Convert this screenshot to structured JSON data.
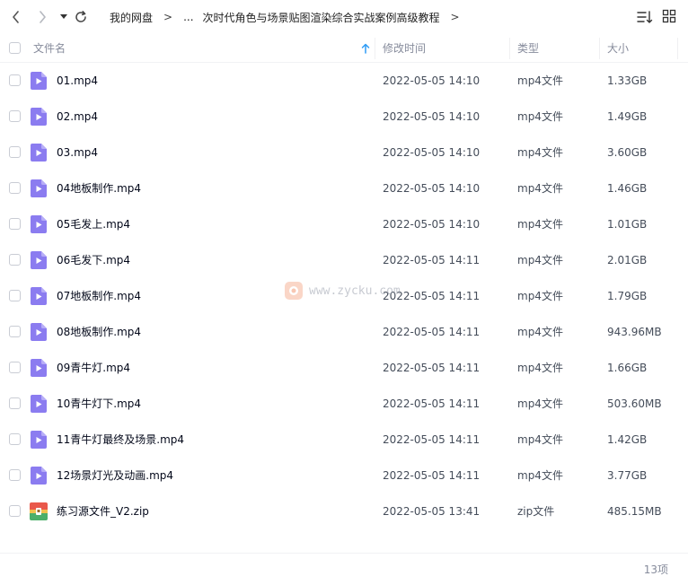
{
  "toolbar": {
    "back_icon": "chevron-left-icon",
    "forward_icon": "chevron-right-icon",
    "history_dropdown_icon": "caret-down-icon",
    "refresh_icon": "refresh-icon",
    "sort_icon": "sort-list-icon",
    "view_icon": "grid-view-icon"
  },
  "breadcrumb": {
    "root": "我的网盘",
    "separator": ">",
    "ellipsis": "...",
    "current": "次时代角色与场景贴图渲染综合实战案例高级教程",
    "trailing": ">"
  },
  "table": {
    "headers": {
      "name": "文件名",
      "modified": "修改时间",
      "type": "类型",
      "size": "大小"
    },
    "sort_indicator": "up-arrow-icon",
    "rows": [
      {
        "name": "01.mp4",
        "modified": "2022-05-05 14:10",
        "type": "mp4文件",
        "size": "1.33GB",
        "icon": "video-file-icon"
      },
      {
        "name": "02.mp4",
        "modified": "2022-05-05 14:10",
        "type": "mp4文件",
        "size": "1.49GB",
        "icon": "video-file-icon"
      },
      {
        "name": "03.mp4",
        "modified": "2022-05-05 14:10",
        "type": "mp4文件",
        "size": "3.60GB",
        "icon": "video-file-icon"
      },
      {
        "name": "04地板制作.mp4",
        "modified": "2022-05-05 14:10",
        "type": "mp4文件",
        "size": "1.46GB",
        "icon": "video-file-icon"
      },
      {
        "name": "05毛发上.mp4",
        "modified": "2022-05-05 14:10",
        "type": "mp4文件",
        "size": "1.01GB",
        "icon": "video-file-icon"
      },
      {
        "name": "06毛发下.mp4",
        "modified": "2022-05-05 14:11",
        "type": "mp4文件",
        "size": "2.01GB",
        "icon": "video-file-icon"
      },
      {
        "name": "07地板制作.mp4",
        "modified": "2022-05-05 14:11",
        "type": "mp4文件",
        "size": "1.79GB",
        "icon": "video-file-icon"
      },
      {
        "name": "08地板制作.mp4",
        "modified": "2022-05-05 14:11",
        "type": "mp4文件",
        "size": "943.96MB",
        "icon": "video-file-icon"
      },
      {
        "name": "09青牛灯.mp4",
        "modified": "2022-05-05 14:11",
        "type": "mp4文件",
        "size": "1.66GB",
        "icon": "video-file-icon"
      },
      {
        "name": "10青牛灯下.mp4",
        "modified": "2022-05-05 14:11",
        "type": "mp4文件",
        "size": "503.60MB",
        "icon": "video-file-icon"
      },
      {
        "name": "11青牛灯最终及场景.mp4",
        "modified": "2022-05-05 14:11",
        "type": "mp4文件",
        "size": "1.42GB",
        "icon": "video-file-icon"
      },
      {
        "name": "12场景灯光及动画.mp4",
        "modified": "2022-05-05 14:11",
        "type": "mp4文件",
        "size": "3.77GB",
        "icon": "video-file-icon"
      },
      {
        "name": "练习源文件_V2.zip",
        "modified": "2022-05-05 13:41",
        "type": "zip文件",
        "size": "485.15MB",
        "icon": "zip-file-icon"
      }
    ]
  },
  "watermark": {
    "text": "www.zycku.com",
    "icon": "watermark-logo-icon"
  },
  "footer": {
    "count": "13项"
  },
  "colors": {
    "video_icon": "#8b7cf0",
    "video_icon_fold": "#b7adf7",
    "zip_icon_top": "#e9584b",
    "zip_icon_bottom": "#4caf6a",
    "sort_arrow": "#2f9cf5"
  }
}
